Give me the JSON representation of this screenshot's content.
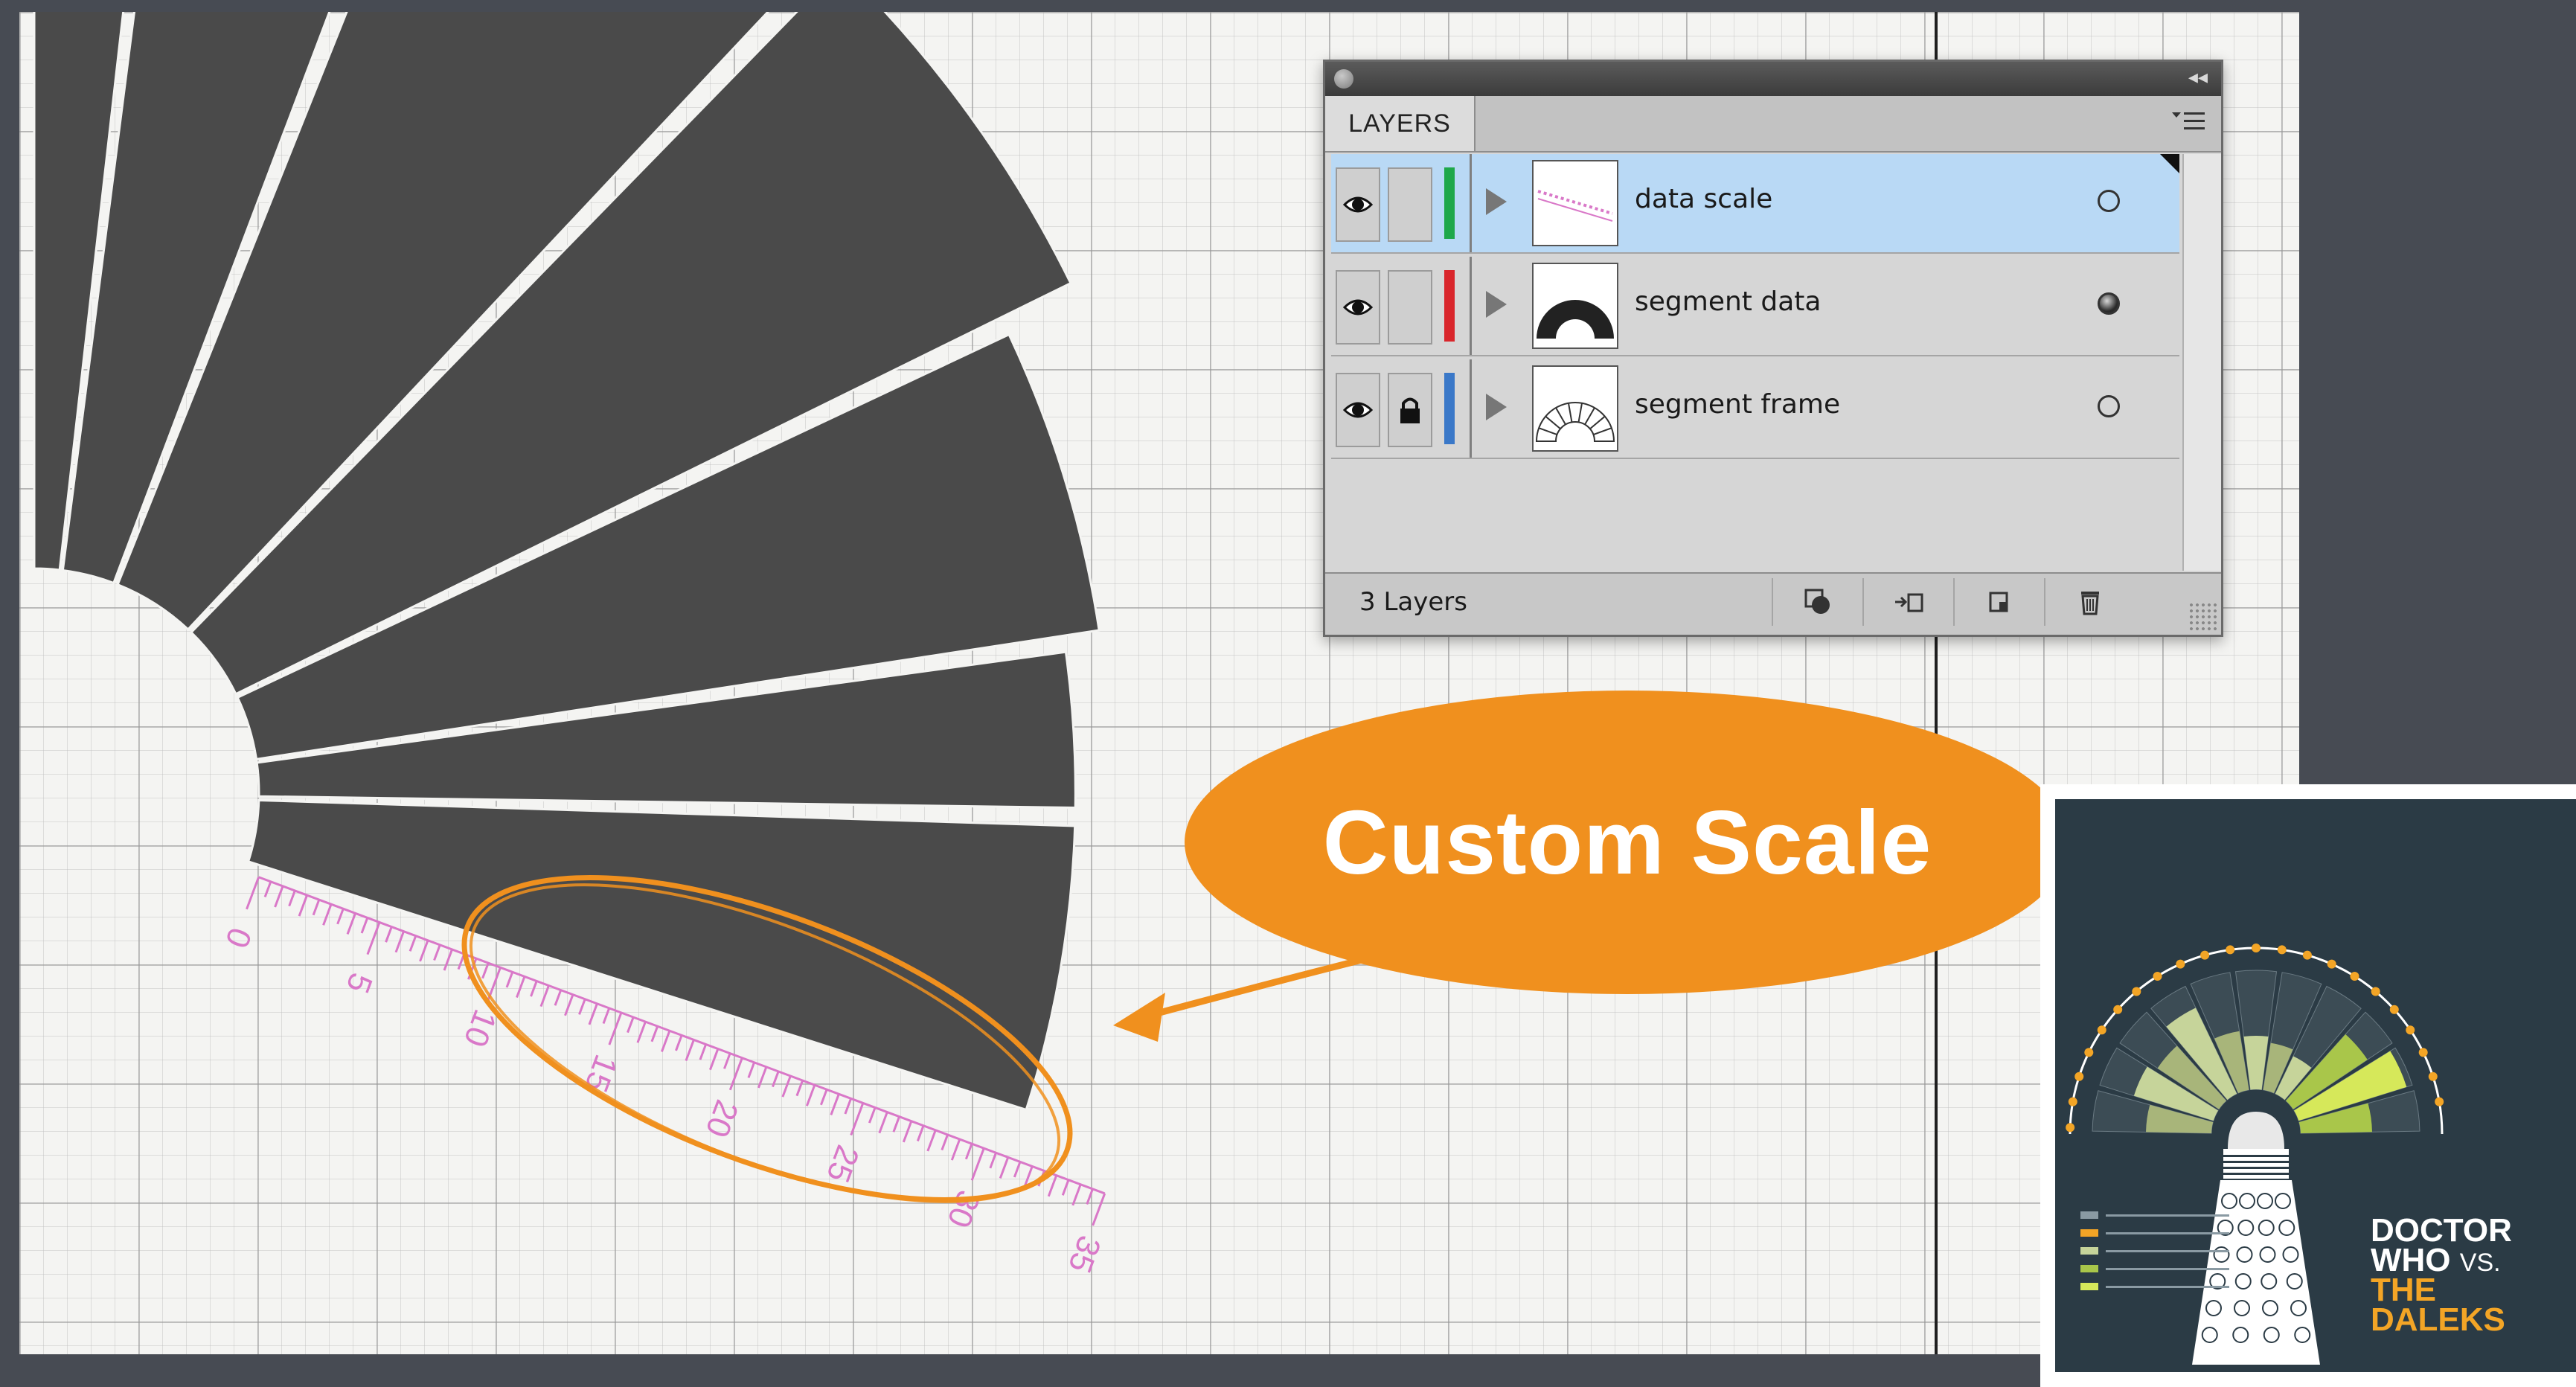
{
  "layers_panel": {
    "tab_label": "LAYERS",
    "collapse_glyph": "◂◂",
    "layers": [
      {
        "name": "data scale",
        "color": "#1fa84a",
        "locked": false,
        "visible": true,
        "selected": true,
        "target": "empty"
      },
      {
        "name": "segment data",
        "color": "#d9262b",
        "locked": false,
        "visible": true,
        "selected": false,
        "target": "filled"
      },
      {
        "name": "segment frame",
        "color": "#3a78c8",
        "locked": true,
        "visible": true,
        "selected": false,
        "target": "empty"
      }
    ],
    "layer_count": "3 Layers",
    "footer_buttons": [
      "make-clipping-mask-icon",
      "create-sublayer-icon",
      "create-new-layer-icon",
      "trash-icon"
    ]
  },
  "callout": {
    "text": "Custom Scale",
    "color": "#f0901e"
  },
  "scale": {
    "ticks": [
      "0",
      "5",
      "10",
      "15",
      "20",
      "25",
      "30",
      "35"
    ],
    "color": "#d978c8"
  },
  "poster": {
    "title_line1": "DOCTOR",
    "title_line2": "WHO",
    "title_vs": "VS.",
    "title_line3": "THE",
    "title_line4": "DALEKS",
    "accent": "#f3a526",
    "background": "#2b3b45"
  },
  "colors": {
    "segment_fill": "#4a4a4a",
    "artboard": "#f4f4f2",
    "desktop": "#474b53"
  }
}
